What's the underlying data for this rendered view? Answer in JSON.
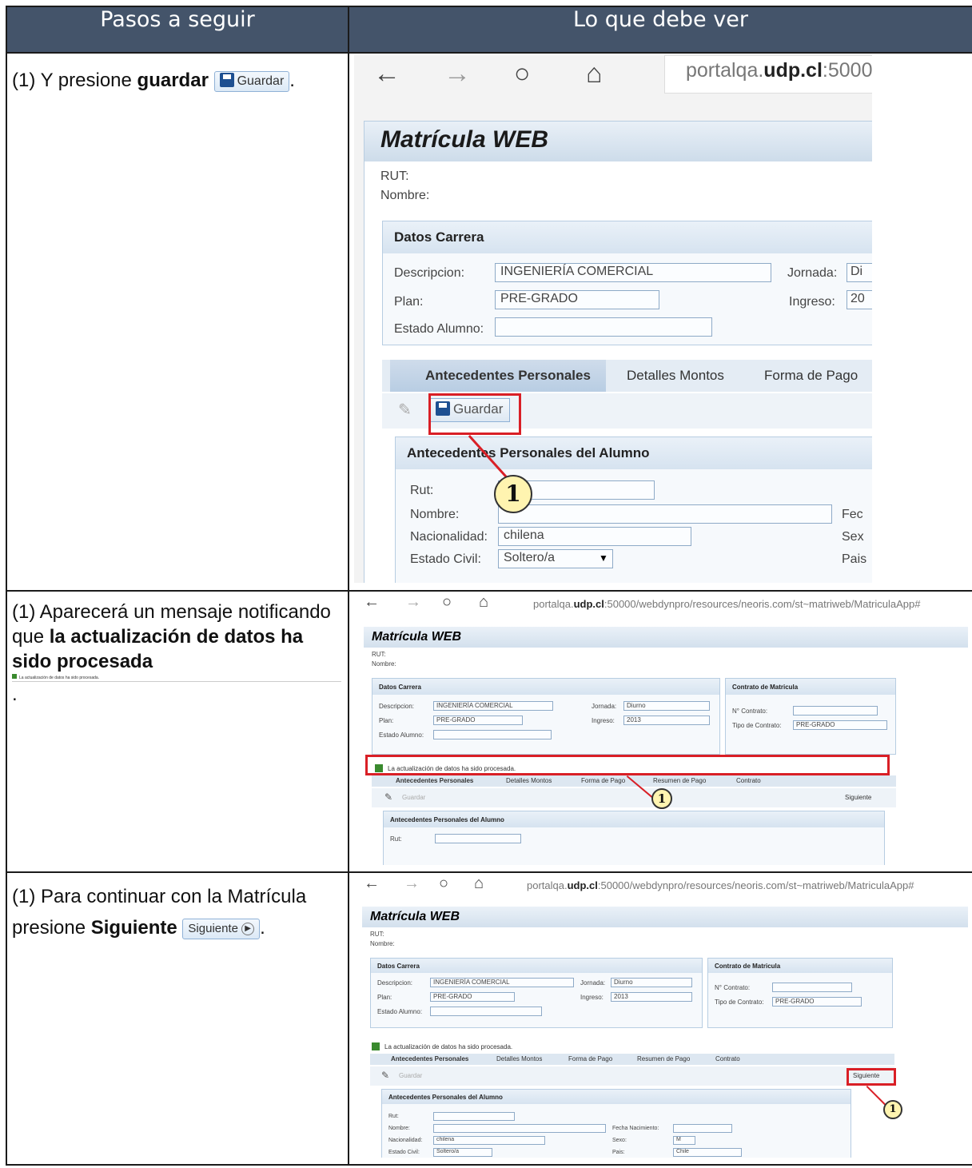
{
  "header": {
    "col_left": "Pasos a seguir",
    "col_right": "Lo que debe ver"
  },
  "step1": {
    "text_pre": "(1) Y presione ",
    "text_bold": "guardar",
    "text_post": ".",
    "btn_label": "Guardar",
    "browser_url_host": "portalqa.",
    "browser_url_domain": "udp.cl",
    "browser_url_tail": ":5000",
    "app_title": "Matrícula WEB",
    "rut_label": "RUT:",
    "nombre_label": "Nombre:",
    "datos_carrera": "Datos Carrera",
    "descripcion_label": "Descripcion:",
    "descripcion_value": "INGENIERÍA COMERCIAL",
    "jornada_label": "Jornada:",
    "jornada_value": "Di",
    "plan_label": "Plan:",
    "plan_value": "PRE-GRADO",
    "ingreso_label": "Ingreso:",
    "ingreso_value": "20",
    "estado_label": "Estado Alumno:",
    "tab1": "Antecedentes Personales",
    "tab2": "Detalles Montos",
    "tab3": "Forma de Pago",
    "guardar": "Guardar",
    "section_title": "Antecedentes Personales del Alumno",
    "rut_field_label": "Rut:",
    "nombre_field_label": "Nombre:",
    "nacionalidad_label": "Nacionalidad:",
    "nacionalidad_value": "chilena",
    "estado_civil_label": "Estado Civil:",
    "estado_civil_value": "Soltero/a",
    "fec_label": "Fec",
    "sex_label": "Sex",
    "pais_label": "Pais",
    "callout": "1"
  },
  "step2": {
    "text_pre": "(1) Aparecerá un mensaje notificando que ",
    "text_bold": "la actualización de datos ha sido procesada",
    "mini_msg": "La actualización de datos ha sido procesada.",
    "dot": ".",
    "browser_url_host": "portalqa.",
    "browser_url_domain": "udp.cl",
    "browser_url_tail": ":50000/webdynpro/resources/neoris.com/st~matriweb/MatriculaApp#",
    "app_title": "Matrícula WEB",
    "rut_label": "RUT:",
    "nombre_label": "Nombre:",
    "datos_carrera": "Datos Carrera",
    "contrato_title": "Contrato de Matricula",
    "descripcion_label": "Descripcion:",
    "descripcion_value": "INGENIERÍA COMERCIAL",
    "jornada_label": "Jornada:",
    "jornada_value": "Diurno",
    "plan_label": "Plan:",
    "plan_value": "PRE-GRADO",
    "ingreso_label": "Ingreso:",
    "ingreso_value": "2013",
    "estado_label": "Estado Alumno:",
    "n_contrato_label": "N° Contrato:",
    "tipo_contrato_label": "Tipo de Contrato:",
    "tipo_contrato_value": "PRE-GRADO",
    "msg": "La actualización de datos ha sido procesada.",
    "tab1": "Antecedentes Personales",
    "tab2": "Detalles Montos",
    "tab3": "Forma de Pago",
    "tab4": "Resumen de Pago",
    "tab5": "Contrato",
    "guardar": "Guardar",
    "siguiente": "Siguiente",
    "section_title": "Antecedentes Personales del Alumno",
    "rut_field_label": "Rut:",
    "callout": "1"
  },
  "step3": {
    "text_pre": "(1) Para continuar con la Matrícula presione ",
    "text_bold": "Siguiente",
    "text_post": ".",
    "btn_label": "Siguiente",
    "browser_url_host": "portalqa.",
    "browser_url_domain": "udp.cl",
    "browser_url_tail": ":50000/webdynpro/resources/neoris.com/st~matriweb/MatriculaApp#",
    "app_title": "Matrícula WEB",
    "rut_label": "RUT:",
    "nombre_label": "Nombre:",
    "datos_carrera": "Datos Carrera",
    "contrato_title": "Contrato de Matricula",
    "descripcion_label": "Descripcion:",
    "descripcion_value": "INGENIERÍA COMERCIAL",
    "jornada_label": "Jornada:",
    "jornada_value": "Diurno",
    "plan_label": "Plan:",
    "plan_value": "PRE-GRADO",
    "ingreso_label": "Ingreso:",
    "ingreso_value": "2013",
    "estado_label": "Estado Alumno:",
    "n_contrato_label": "N° Contrato:",
    "tipo_contrato_label": "Tipo de Contrato:",
    "tipo_contrato_value": "PRE-GRADO",
    "msg": "La actualización de datos ha sido procesada.",
    "tab1": "Antecedentes Personales",
    "tab2": "Detalles Montos",
    "tab3": "Forma de Pago",
    "tab4": "Resumen de Pago",
    "tab5": "Contrato",
    "guardar": "Guardar",
    "siguiente": "Siguiente",
    "section_title": "Antecedentes Personales del Alumno",
    "rut_field_label": "Rut:",
    "nombre_field_label": "Nombre:",
    "fecha_nac_label": "Fecha Nacimiento:",
    "nacionalidad_label": "Nacionalidad:",
    "nacionalidad_value": "chilena",
    "sexo_label": "Sexo:",
    "sexo_value": "M",
    "estado_civil_label": "Estado Civil:",
    "estado_civil_value": "Soltero/a",
    "pais_label": "Pais:",
    "pais_value": "Chile",
    "callout": "1"
  }
}
